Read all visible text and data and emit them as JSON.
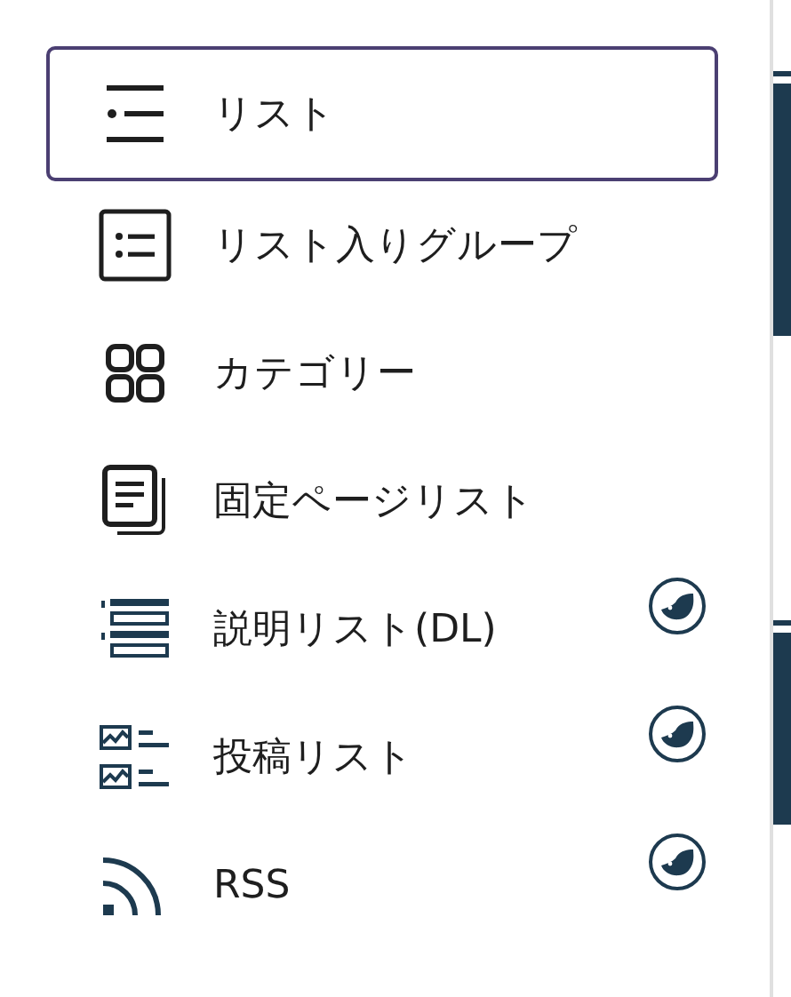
{
  "items": [
    {
      "label": "リスト",
      "kind": "list",
      "selected": true,
      "badge": false
    },
    {
      "label": "リスト入りグループ",
      "kind": "group",
      "selected": false,
      "badge": false
    },
    {
      "label": "カテゴリー",
      "kind": "categories",
      "selected": false,
      "badge": false
    },
    {
      "label": "固定ページリスト",
      "kind": "pages",
      "selected": false,
      "badge": false
    },
    {
      "label": "説明リスト(DL)",
      "kind": "description",
      "selected": false,
      "badge": true
    },
    {
      "label": "投稿リスト",
      "kind": "posts",
      "selected": false,
      "badge": true
    },
    {
      "label": "RSS",
      "kind": "rss",
      "selected": false,
      "badge": true
    }
  ]
}
